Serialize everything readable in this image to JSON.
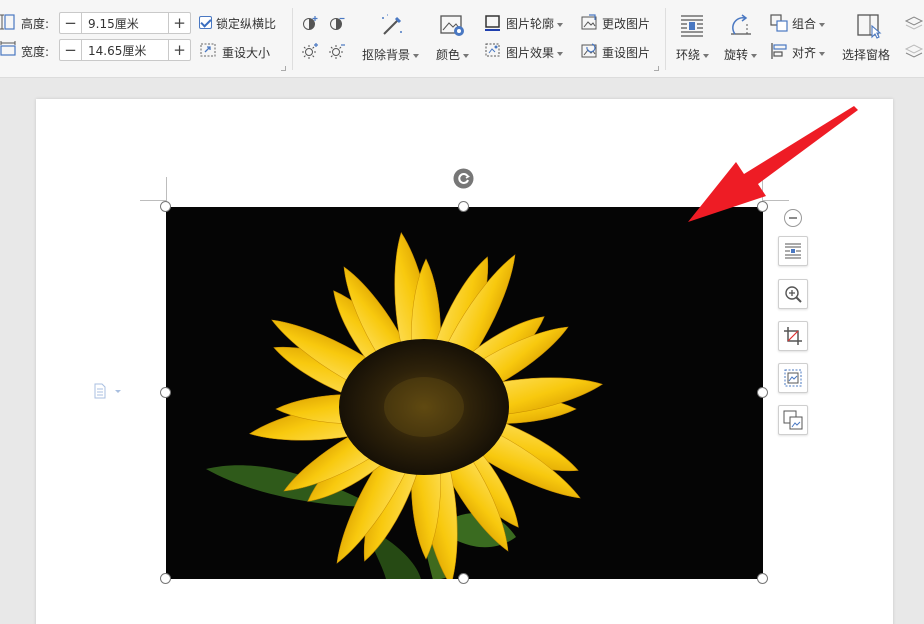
{
  "size": {
    "height_label": "高度:",
    "height_value": "9.15厘米",
    "width_label": "宽度:",
    "width_value": "14.65厘米",
    "lock_aspect_label": "锁定纵横比",
    "lock_aspect_checked": true,
    "reset_size_label": "重设大小"
  },
  "image_tools": {
    "remove_background": "抠除背景",
    "color": "颜色"
  },
  "picture_style": {
    "outline": "图片轮廓",
    "effects": "图片效果",
    "change_picture": "更改图片",
    "reset_picture": "重设图片"
  },
  "arrange": {
    "wrap": "环绕",
    "rotate": "旋转",
    "group": "组合",
    "align": "对齐",
    "selection_pane": "选择窗格"
  },
  "colors": {
    "accent": "#3f6fc4",
    "annotation_arrow": "#ee1c25"
  }
}
